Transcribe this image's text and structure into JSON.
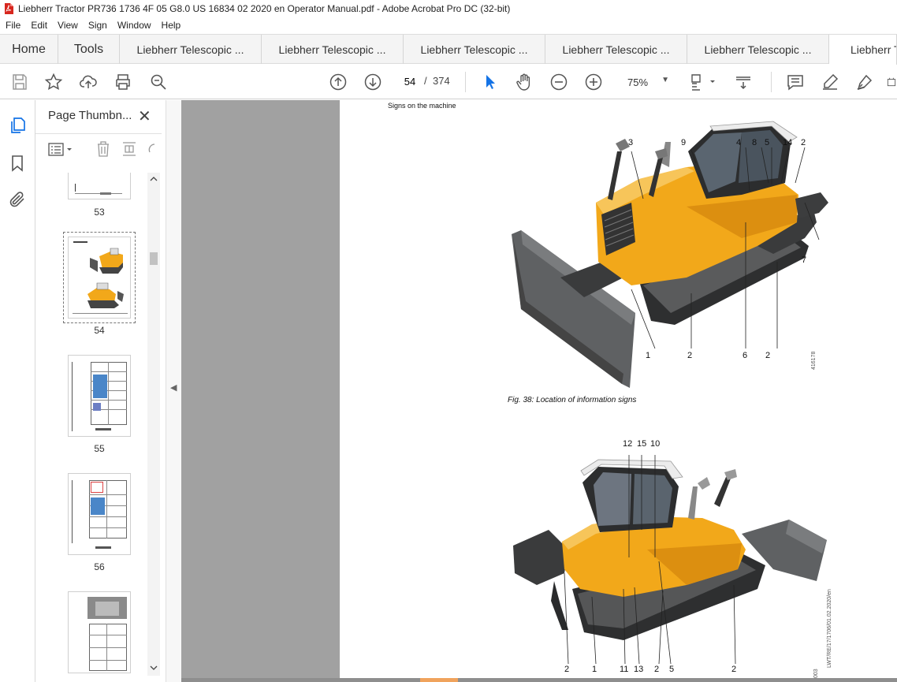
{
  "window": {
    "title": "Liebherr Tractor PR736 1736 4F 05 G8.0 US 16834 02 2020 en Operator Manual.pdf - Adobe Acrobat Pro DC (32-bit)"
  },
  "menu": [
    "File",
    "Edit",
    "View",
    "Sign",
    "Window",
    "Help"
  ],
  "tabs": {
    "home": "Home",
    "tools": "Tools",
    "docs": [
      "Liebherr Telescopic ...",
      "Liebherr Telescopic ...",
      "Liebherr Telescopic ...",
      "Liebherr Telescopic ...",
      "Liebherr Telescopic ..."
    ],
    "active": "Liebherr T"
  },
  "toolbar": {
    "page_current": "54",
    "page_separator": "/",
    "page_total": "374",
    "zoom": "75%"
  },
  "thumbnails": {
    "title": "Page Thumbn...",
    "pages": [
      "53",
      "54",
      "55",
      "56"
    ]
  },
  "page": {
    "header": "Signs on the machine",
    "figure_caption": "Fig. 38: Location of information signs",
    "figure_id_top": "416178",
    "figure_id_bottom": "LWT/RE/17/1706/01.02.2020/en",
    "page_marker": "003",
    "callouts_top": {
      "c3": "3",
      "c9": "9",
      "c4": "4",
      "c8": "8",
      "c5": "5",
      "c14": "14",
      "c2a": "2",
      "c7": "7",
      "c1": "1",
      "c2b": "2",
      "c6": "6",
      "c2c": "2"
    },
    "callouts_bottom": {
      "c12": "12",
      "c15": "15",
      "c10": "10",
      "c2a": "2",
      "c1": "1",
      "c11": "11",
      "c13": "13",
      "c2b": "2",
      "c5": "5",
      "c2c": "2"
    }
  },
  "colors": {
    "machine_yellow": "#f2a81a",
    "accent_blue": "#1473e6",
    "doc_background": "#a1a1a1"
  }
}
